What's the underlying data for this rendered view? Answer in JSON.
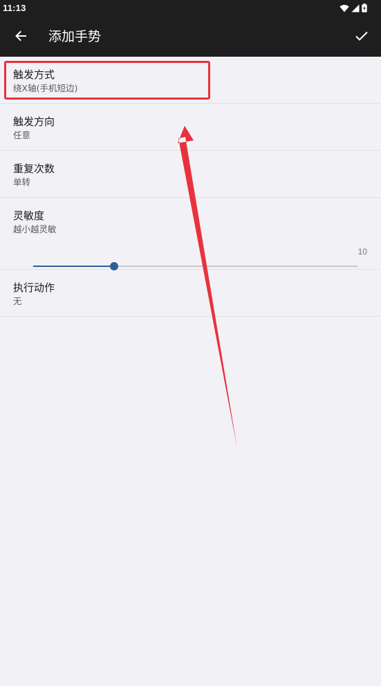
{
  "status_bar": {
    "time": "11:13"
  },
  "app_bar": {
    "title": "添加手势",
    "back_icon": "arrow-back-icon",
    "confirm_icon": "check-icon"
  },
  "preferences": [
    {
      "title": "触发方式",
      "summary": "绕X轴(手机短边)",
      "highlighted": true
    },
    {
      "title": "触发方向",
      "summary": "任意"
    },
    {
      "title": "重复次数",
      "summary": "单转"
    },
    {
      "title": "灵敏度",
      "summary": "越小越灵敏",
      "slider": {
        "value_label": "10",
        "fill_fraction": 0.25
      }
    },
    {
      "title": "执行动作",
      "summary": "无"
    }
  ],
  "colors": {
    "bar_background": "#1e1e1e",
    "page_background": "#f2f1f6",
    "accent": "#2e5f96",
    "annotation_red": "#e8323c"
  }
}
